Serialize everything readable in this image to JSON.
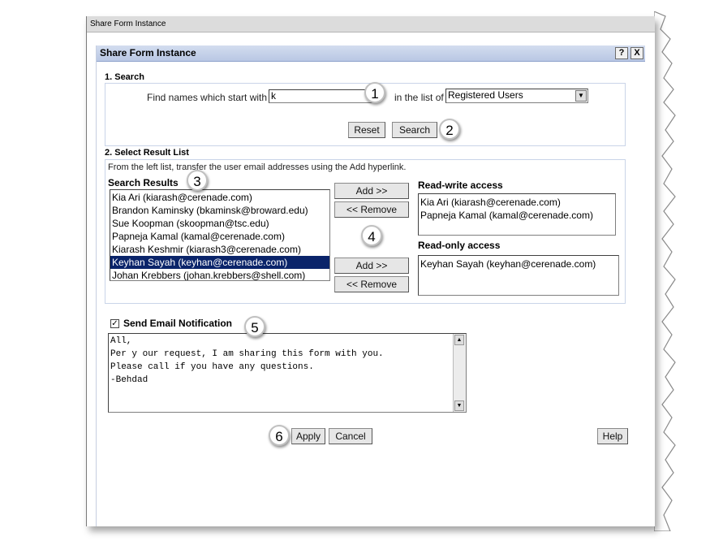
{
  "window": {
    "title": "Share Form Instance"
  },
  "dialog": {
    "title": "Share Form Instance",
    "help_icon": "?",
    "close_icon": "X"
  },
  "search": {
    "heading": "1. Search",
    "find_label": "Find names which start with",
    "find_value": "k",
    "list_label": "in the list of",
    "list_selected": "Registered Users",
    "reset_label": "Reset",
    "search_label": "Search"
  },
  "results": {
    "heading": "2. Select Result List",
    "instruction": "From the left list, transfer the user email addresses using the Add hyperlink.",
    "search_results_label": "Search Results",
    "items": [
      "Kia Ari (kiarash@cerenade.com)",
      "Brandon Kaminsky (bkaminsk@broward.edu)",
      "Sue Koopman (skoopman@tsc.edu)",
      "Papneja Kamal (kamal@cerenade.com)",
      "Kiarash Keshmir (kiarash3@cerenade.com)",
      "Keyhan Sayah (keyhan@cerenade.com)",
      "Johan Krebbers (johan.krebbers@shell.com)"
    ],
    "selected_index": 5,
    "add_label": "Add >>",
    "remove_label": "<< Remove",
    "rw_label": "Read-write access",
    "rw_items": [
      "Kia Ari (kiarash@cerenade.com)",
      "Papneja Kamal (kamal@cerenade.com)"
    ],
    "ro_label": "Read-only access",
    "ro_items": [
      "Keyhan Sayah (keyhan@cerenade.com)"
    ]
  },
  "email": {
    "checkbox_label": "Send Email Notification",
    "checked": true,
    "message": "All,\nPer y our request, I am sharing this form with you.\nPlease call if you have any questions.\n-Behdad"
  },
  "footer": {
    "apply_label": "Apply",
    "cancel_label": "Cancel",
    "help_label": "Help"
  },
  "callouts": [
    "1",
    "2",
    "3",
    "4",
    "5",
    "6"
  ]
}
